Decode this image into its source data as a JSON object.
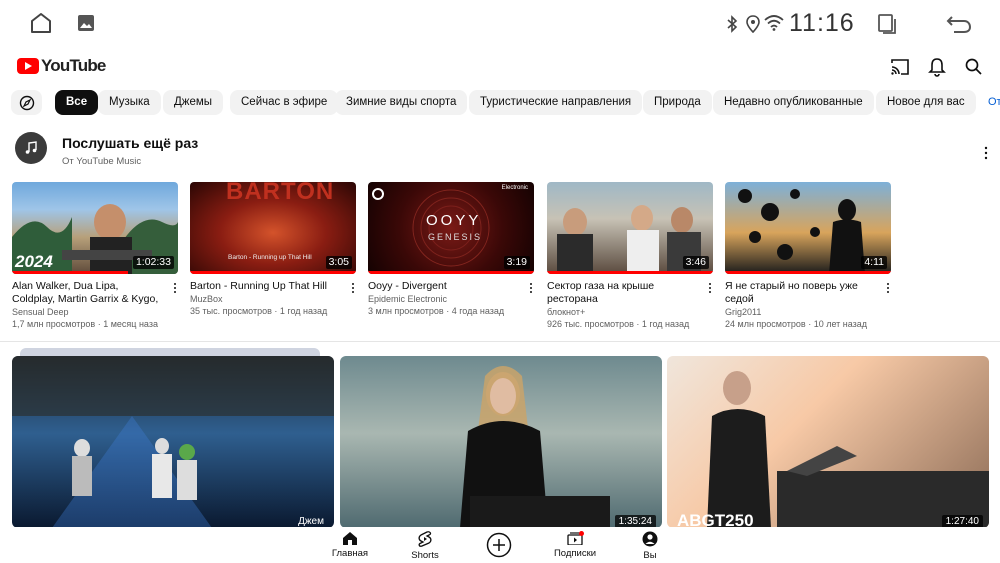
{
  "status_bar": {
    "time": "11:16",
    "icons": [
      "home-icon",
      "gallery-icon",
      "bluetooth-icon",
      "location-icon",
      "wifi-icon",
      "recents-icon",
      "back-icon"
    ]
  },
  "header": {
    "logo_text": "YouTube",
    "icons": [
      "cast-icon",
      "bell-icon",
      "search-icon"
    ]
  },
  "chips": {
    "items": [
      "Все",
      "Музыка",
      "Джемы",
      "Сейчас в эфире",
      "Зимние виды спорта",
      "Туристические направления",
      "Природа",
      "Недавно опубликованные",
      "Новое для вас"
    ],
    "active": "Все",
    "overflow_text": "От"
  },
  "section": {
    "title": "Послушать ещё раз",
    "subtitle": "От YouTube Music"
  },
  "cards": [
    {
      "title": "Alan Walker, Dua Lipa, Coldplay, Martin Garrix & Kygo, The Chai...",
      "channel": "Sensual Deep",
      "stats": "1,7 млн просмотров · 1 месяц наза",
      "duration": "1:02:33",
      "progress": 0.7
    },
    {
      "title": "Barton - Running Up That Hill",
      "channel": "MuzBox",
      "stats": "35 тыс. просмотров · 1 год назад",
      "duration": "3:05",
      "progress": 1.0
    },
    {
      "title": "Ooyy - Divergent",
      "channel": "Epidemic Electronic",
      "stats": "3 млн просмотров · 4 года назад",
      "duration": "3:19",
      "progress": 1.0
    },
    {
      "title": "Сектор газа на крыше ресторана",
      "channel": "блокнот+",
      "stats": "926 тыс. просмотров · 1 год назад",
      "duration": "3:46",
      "progress": 1.0
    },
    {
      "title": "Я не старый но поверь уже седой",
      "channel": "Grig2011",
      "stats": "24 млн просмотров · 10 лет назад",
      "duration": "4:11",
      "progress": 1.0
    }
  ],
  "thumb_texts": {
    "card1_overlay": "2024",
    "card2_overlay": "BARTON",
    "card2_caption": "Barton - Running up That Hill",
    "card3_overlay": "OOYY",
    "card3_overlay2": "GENESIS",
    "card3_badge": "Electronic"
  },
  "big_videos": [
    {
      "duration": "",
      "badge": "Джем"
    },
    {
      "duration": "1:35:24",
      "badge": ""
    },
    {
      "duration": "1:27:40",
      "badge": "",
      "overlay": "ABGT250"
    }
  ],
  "bottom_nav": [
    {
      "label": "Главная",
      "icon": "home-filled-icon"
    },
    {
      "label": "Shorts",
      "icon": "shorts-icon"
    },
    {
      "label": "",
      "icon": "create-icon"
    },
    {
      "label": "Подписки",
      "icon": "subscriptions-icon"
    },
    {
      "label": "Вы",
      "icon": "you-avatar-icon"
    }
  ],
  "colors": {
    "accent": "#ff0000",
    "chip_bg": "#f2f2f2",
    "chip_active": "#0f0f0f",
    "text_secondary": "#606060",
    "link": "#065fd4"
  }
}
